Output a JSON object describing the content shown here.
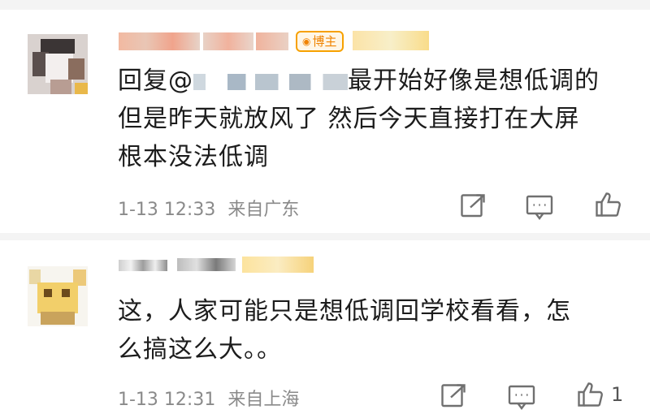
{
  "comments": [
    {
      "badge": "博主",
      "reply_prefix": "回复@",
      "text_line1_tail": "最开始好像是想低调的",
      "text_line2": "但是昨天就放风了 然后今天直接打在大屏",
      "text_line3": "根本没法低调",
      "time": "1-13 12:33",
      "location": "来自广东",
      "likes": ""
    },
    {
      "text_line1": "这，人家可能只是想低调回学校看看，怎",
      "text_line2": "么搞这么大。。",
      "time": "1-13 12:31",
      "location": "来自上海",
      "likes": "1"
    }
  ],
  "icons": [
    "share-icon",
    "comment-icon",
    "like-icon"
  ],
  "colors": {
    "badge": "#f08300",
    "text": "#1c1c1c",
    "meta": "#8a8a8a",
    "background": "#f4f4f4"
  }
}
